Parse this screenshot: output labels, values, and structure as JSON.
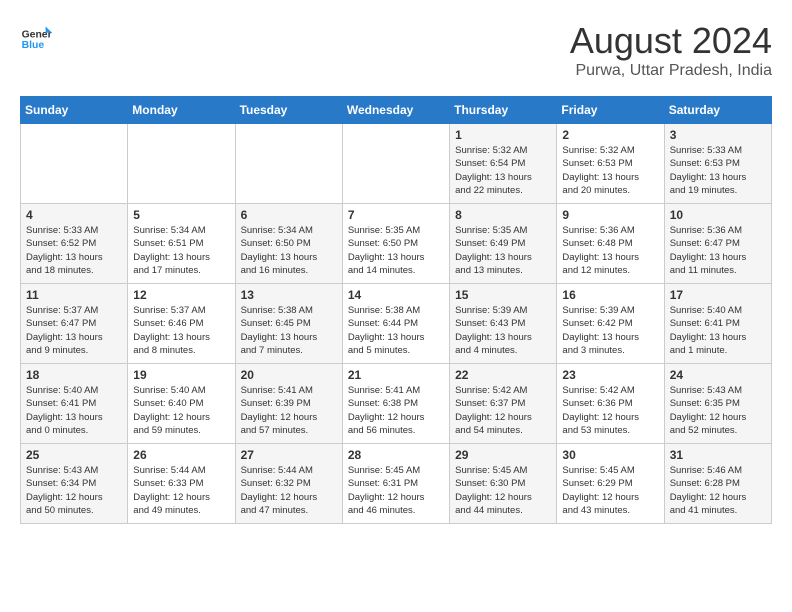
{
  "app": {
    "name": "GeneralBlue",
    "logo_text_1": "General",
    "logo_text_2": "Blue"
  },
  "title": {
    "month_year": "August 2024",
    "location": "Purwa, Uttar Pradesh, India"
  },
  "weekdays": [
    "Sunday",
    "Monday",
    "Tuesday",
    "Wednesday",
    "Thursday",
    "Friday",
    "Saturday"
  ],
  "weeks": [
    [
      {
        "day": "",
        "info": ""
      },
      {
        "day": "",
        "info": ""
      },
      {
        "day": "",
        "info": ""
      },
      {
        "day": "",
        "info": ""
      },
      {
        "day": "1",
        "info": "Sunrise: 5:32 AM\nSunset: 6:54 PM\nDaylight: 13 hours\nand 22 minutes."
      },
      {
        "day": "2",
        "info": "Sunrise: 5:32 AM\nSunset: 6:53 PM\nDaylight: 13 hours\nand 20 minutes."
      },
      {
        "day": "3",
        "info": "Sunrise: 5:33 AM\nSunset: 6:53 PM\nDaylight: 13 hours\nand 19 minutes."
      }
    ],
    [
      {
        "day": "4",
        "info": "Sunrise: 5:33 AM\nSunset: 6:52 PM\nDaylight: 13 hours\nand 18 minutes."
      },
      {
        "day": "5",
        "info": "Sunrise: 5:34 AM\nSunset: 6:51 PM\nDaylight: 13 hours\nand 17 minutes."
      },
      {
        "day": "6",
        "info": "Sunrise: 5:34 AM\nSunset: 6:50 PM\nDaylight: 13 hours\nand 16 minutes."
      },
      {
        "day": "7",
        "info": "Sunrise: 5:35 AM\nSunset: 6:50 PM\nDaylight: 13 hours\nand 14 minutes."
      },
      {
        "day": "8",
        "info": "Sunrise: 5:35 AM\nSunset: 6:49 PM\nDaylight: 13 hours\nand 13 minutes."
      },
      {
        "day": "9",
        "info": "Sunrise: 5:36 AM\nSunset: 6:48 PM\nDaylight: 13 hours\nand 12 minutes."
      },
      {
        "day": "10",
        "info": "Sunrise: 5:36 AM\nSunset: 6:47 PM\nDaylight: 13 hours\nand 11 minutes."
      }
    ],
    [
      {
        "day": "11",
        "info": "Sunrise: 5:37 AM\nSunset: 6:47 PM\nDaylight: 13 hours\nand 9 minutes."
      },
      {
        "day": "12",
        "info": "Sunrise: 5:37 AM\nSunset: 6:46 PM\nDaylight: 13 hours\nand 8 minutes."
      },
      {
        "day": "13",
        "info": "Sunrise: 5:38 AM\nSunset: 6:45 PM\nDaylight: 13 hours\nand 7 minutes."
      },
      {
        "day": "14",
        "info": "Sunrise: 5:38 AM\nSunset: 6:44 PM\nDaylight: 13 hours\nand 5 minutes."
      },
      {
        "day": "15",
        "info": "Sunrise: 5:39 AM\nSunset: 6:43 PM\nDaylight: 13 hours\nand 4 minutes."
      },
      {
        "day": "16",
        "info": "Sunrise: 5:39 AM\nSunset: 6:42 PM\nDaylight: 13 hours\nand 3 minutes."
      },
      {
        "day": "17",
        "info": "Sunrise: 5:40 AM\nSunset: 6:41 PM\nDaylight: 13 hours\nand 1 minute."
      }
    ],
    [
      {
        "day": "18",
        "info": "Sunrise: 5:40 AM\nSunset: 6:41 PM\nDaylight: 13 hours\nand 0 minutes."
      },
      {
        "day": "19",
        "info": "Sunrise: 5:40 AM\nSunset: 6:40 PM\nDaylight: 12 hours\nand 59 minutes."
      },
      {
        "day": "20",
        "info": "Sunrise: 5:41 AM\nSunset: 6:39 PM\nDaylight: 12 hours\nand 57 minutes."
      },
      {
        "day": "21",
        "info": "Sunrise: 5:41 AM\nSunset: 6:38 PM\nDaylight: 12 hours\nand 56 minutes."
      },
      {
        "day": "22",
        "info": "Sunrise: 5:42 AM\nSunset: 6:37 PM\nDaylight: 12 hours\nand 54 minutes."
      },
      {
        "day": "23",
        "info": "Sunrise: 5:42 AM\nSunset: 6:36 PM\nDaylight: 12 hours\nand 53 minutes."
      },
      {
        "day": "24",
        "info": "Sunrise: 5:43 AM\nSunset: 6:35 PM\nDaylight: 12 hours\nand 52 minutes."
      }
    ],
    [
      {
        "day": "25",
        "info": "Sunrise: 5:43 AM\nSunset: 6:34 PM\nDaylight: 12 hours\nand 50 minutes."
      },
      {
        "day": "26",
        "info": "Sunrise: 5:44 AM\nSunset: 6:33 PM\nDaylight: 12 hours\nand 49 minutes."
      },
      {
        "day": "27",
        "info": "Sunrise: 5:44 AM\nSunset: 6:32 PM\nDaylight: 12 hours\nand 47 minutes."
      },
      {
        "day": "28",
        "info": "Sunrise: 5:45 AM\nSunset: 6:31 PM\nDaylight: 12 hours\nand 46 minutes."
      },
      {
        "day": "29",
        "info": "Sunrise: 5:45 AM\nSunset: 6:30 PM\nDaylight: 12 hours\nand 44 minutes."
      },
      {
        "day": "30",
        "info": "Sunrise: 5:45 AM\nSunset: 6:29 PM\nDaylight: 12 hours\nand 43 minutes."
      },
      {
        "day": "31",
        "info": "Sunrise: 5:46 AM\nSunset: 6:28 PM\nDaylight: 12 hours\nand 41 minutes."
      }
    ]
  ]
}
